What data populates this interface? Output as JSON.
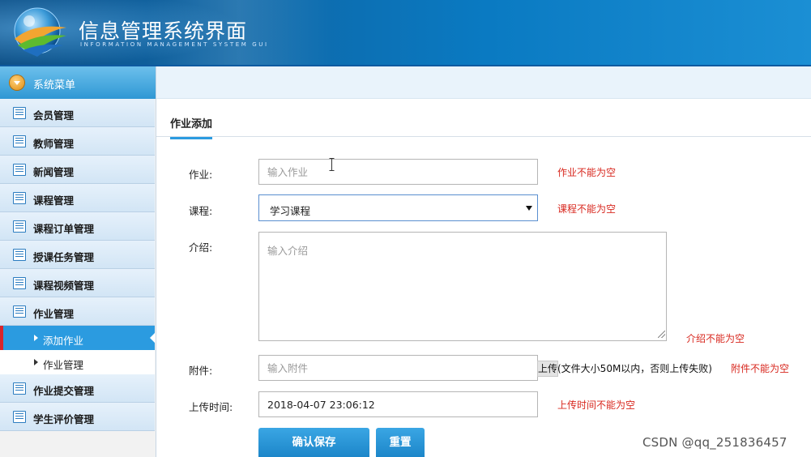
{
  "header": {
    "title": "信息管理系统界面",
    "subtitle": "INFORMATION MANAGEMENT SYSTEM GUI"
  },
  "sidebar": {
    "menu_title": "系统菜单",
    "items": [
      {
        "label": "会员管理"
      },
      {
        "label": "教师管理"
      },
      {
        "label": "新闻管理"
      },
      {
        "label": "课程管理"
      },
      {
        "label": "课程订单管理"
      },
      {
        "label": "授课任务管理"
      },
      {
        "label": "课程视频管理"
      },
      {
        "label": "作业管理"
      }
    ],
    "sub_items": [
      {
        "label": "添加作业",
        "active": true
      },
      {
        "label": "作业管理",
        "active": false
      }
    ],
    "items_after": [
      {
        "label": "作业提交管理"
      },
      {
        "label": "学生评价管理"
      }
    ]
  },
  "tab": {
    "label": "作业添加"
  },
  "form": {
    "homework": {
      "label": "作业:",
      "placeholder": "输入作业",
      "value": "",
      "error": "作业不能为空"
    },
    "course": {
      "label": "课程:",
      "selected": "学习课程",
      "error": "课程不能为空"
    },
    "intro": {
      "label": "介绍:",
      "placeholder": "输入介绍",
      "value": "",
      "error": "介绍不能为空"
    },
    "attachment": {
      "label": "附件:",
      "placeholder": "输入附件",
      "value": "",
      "upload_label": "上传",
      "upload_note": "(文件大小50M以内，否则上传失败)",
      "error": "附件不能为空"
    },
    "upload_time": {
      "label": "上传时间:",
      "value": "2018-04-07 23:06:12",
      "error": "上传时间不能为空"
    },
    "save_label": "确认保存",
    "reset_label": "重置"
  },
  "watermark": "CSDN @qq_251836457",
  "colors": {
    "accent": "#2b9be0",
    "error": "#d8281f",
    "active_marker": "#d9252b"
  }
}
